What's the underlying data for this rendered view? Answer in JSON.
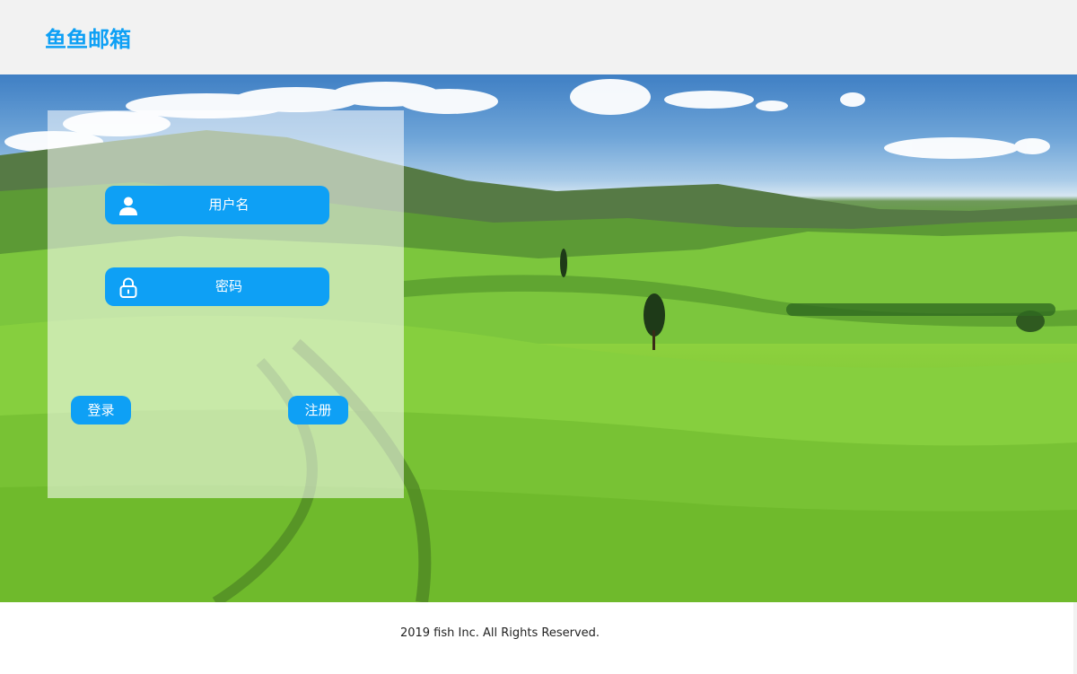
{
  "header": {
    "logo_text": "鱼鱼邮箱"
  },
  "login": {
    "username_label": "用户名",
    "password_label": "密码",
    "login_button": "登录",
    "register_button": "注册"
  },
  "footer": {
    "copyright": "2019 fish Inc. All Rights Reserved."
  },
  "colors": {
    "accent": "#0ea0f5",
    "page_bg": "#f2f2f2"
  },
  "icons": {
    "username": "user-icon",
    "password": "lock-icon"
  }
}
